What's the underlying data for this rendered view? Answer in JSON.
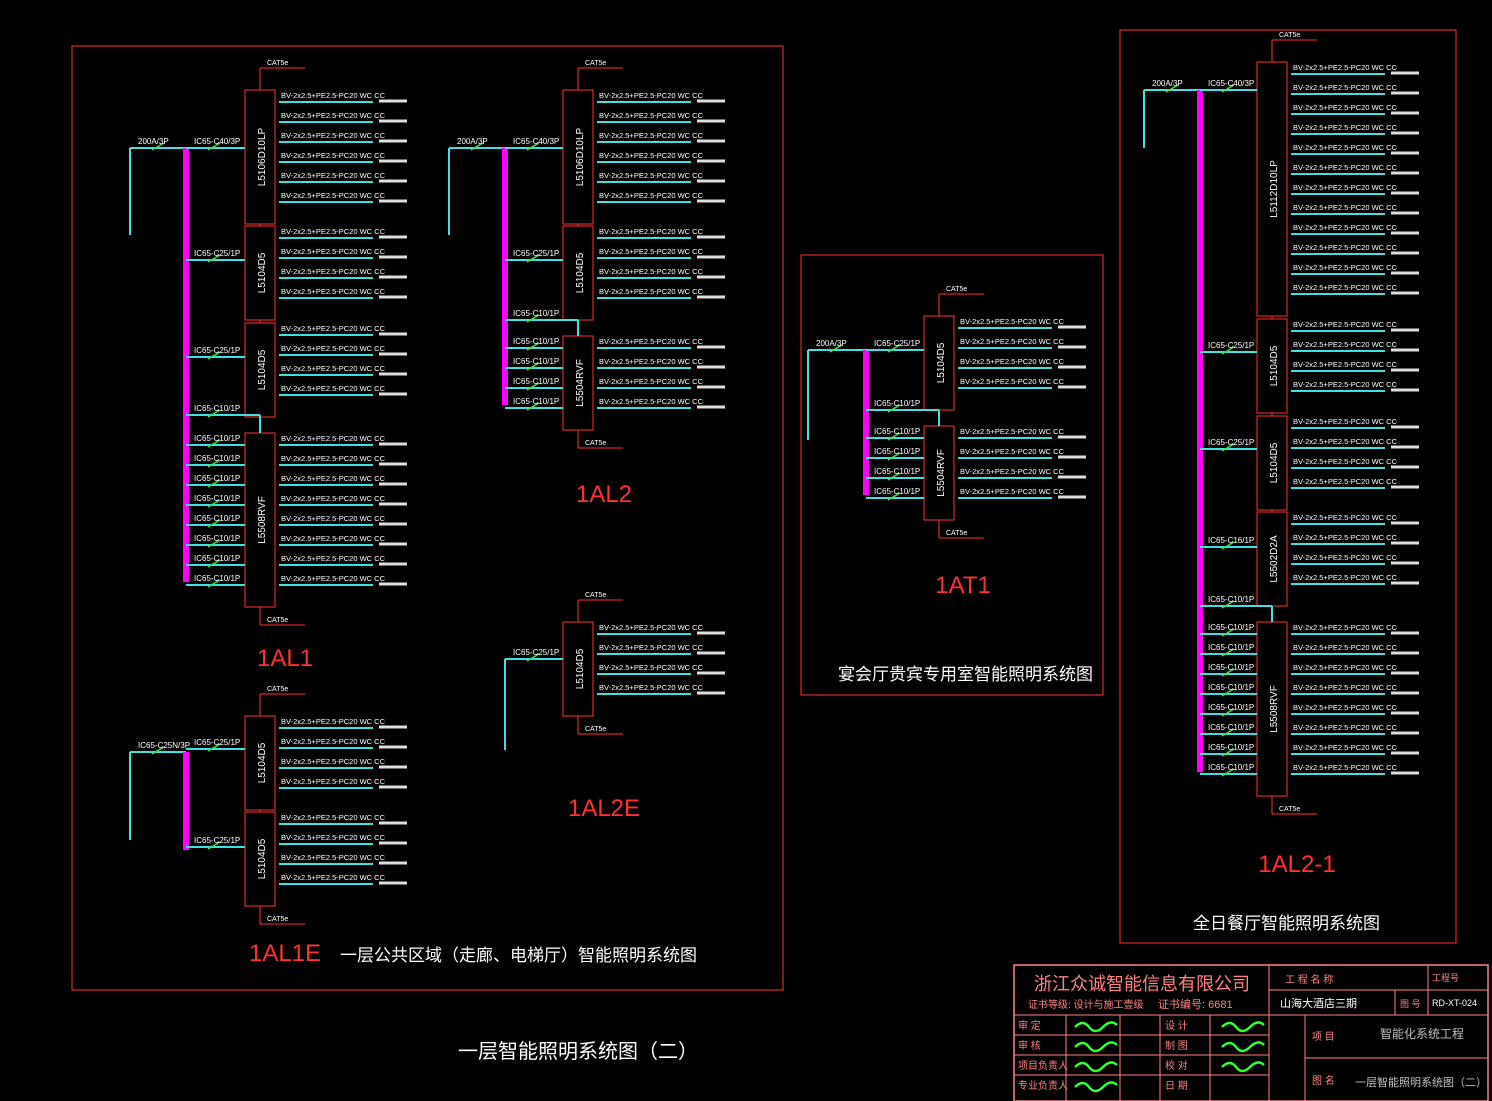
{
  "colors": {
    "background": "#000000",
    "frame": "#ff3030",
    "bus": "#ff00ff",
    "cable": "#40e0e0",
    "breaker": "#40e040",
    "text": "#ffffff",
    "label": "#ff3030",
    "title": "#ffffff",
    "titleblock": "#ff8080",
    "signature": "#30ff30"
  },
  "cable_spec": "BV-2x2.5+PE2.5-PC20 WC CC",
  "network_label": "CAT5e",
  "sheet_title": "一层智能照明系统图（二）",
  "diagrams": [
    {
      "id": "1AL1",
      "label": "1AL1",
      "feeder": "200A/3P",
      "modules": [
        {
          "name": "L5106D10LP",
          "breaker": "IC65-C40/3P",
          "circuits": 6
        },
        {
          "name": "L5104D5",
          "breaker": "IC65-C25/1P",
          "circuits": 4
        },
        {
          "name": "L5104D5",
          "breaker": "IC65-C25/1P",
          "circuits": 4
        },
        {
          "name": "L5508RVF",
          "breaker": "IC65-C10/1P",
          "circuits": 8,
          "branch_breakers": [
            "IC65-C10/1P",
            "IC65-C10/1P",
            "IC65-C10/1P",
            "IC65-C10/1P",
            "IC65-C10/1P",
            "IC65-C10/1P",
            "IC65-C10/1P",
            "IC65-C10/1P"
          ]
        }
      ]
    },
    {
      "id": "1AL2",
      "label": "1AL2",
      "feeder": "200A/3P",
      "modules": [
        {
          "name": "L5106D10LP",
          "breaker": "IC65-C40/3P",
          "circuits": 6
        },
        {
          "name": "L5104D5",
          "breaker": "IC65-C25/1P",
          "circuits": 4
        },
        {
          "name": "L5504RVF",
          "breaker": "IC65-C10/1P",
          "circuits": 4,
          "branch_breakers": [
            "IC65-C10/1P",
            "IC65-C10/1P",
            "IC65-C10/1P",
            "IC65-C10/1P"
          ]
        }
      ]
    },
    {
      "id": "1AL1E",
      "label": "1AL1E",
      "title": "一层公共区域（走廊、电梯厅）智能照明系统图",
      "feeder": "IC65-C25N/3P",
      "modules": [
        {
          "name": "L5104D5",
          "breaker": "IC65-C25/1P",
          "circuits": 4
        },
        {
          "name": "L5104D5",
          "breaker": "IC65-C25/1P",
          "circuits": 4
        }
      ]
    },
    {
      "id": "1AL2E",
      "label": "1AL2E",
      "modules": [
        {
          "name": "L5104D5",
          "breaker": "IC65-C25/1P",
          "circuits": 4
        }
      ]
    },
    {
      "id": "1AT1",
      "label": "1AT1",
      "title": "宴会厅贵宾专用室智能照明系统图",
      "feeder": "200A/3P",
      "modules": [
        {
          "name": "L5104D5",
          "breaker": "IC65-C25/1P",
          "circuits": 4
        },
        {
          "name": "L5504RVF",
          "breaker": "IC65-C10/1P",
          "circuits": 4,
          "branch_breakers": [
            "IC65-C10/1P",
            "IC65-C10/1P",
            "IC65-C10/1P",
            "IC65-C10/1P"
          ]
        }
      ]
    },
    {
      "id": "1AL2-1",
      "label": "1AL2-1",
      "title": "全日餐厅智能照明系统图",
      "feeder": "200A/3P",
      "modules": [
        {
          "name": "L5112D10LP",
          "breaker": "IC65-C40/3P",
          "circuits": 12
        },
        {
          "name": "L5104D5",
          "breaker": "IC65-C25/1P",
          "circuits": 4
        },
        {
          "name": "L5104D5",
          "breaker": "IC65-C25/1P",
          "circuits": 4
        },
        {
          "name": "L5502D2A",
          "breaker": "IC65-C16/1P",
          "circuits": 4
        },
        {
          "name": "L5508RVF",
          "breaker": "IC65-C10/1P",
          "circuits": 8,
          "branch_breakers": [
            "IC65-C10/1P",
            "IC65-C10/1P",
            "IC65-C10/1P",
            "IC65-C10/1P",
            "IC65-C10/1P",
            "IC65-C10/1P",
            "IC65-C10/1P",
            "IC65-C10/1P"
          ]
        }
      ]
    }
  ],
  "title_block": {
    "company": "浙江众诚智能信息有限公司",
    "cert_level": "证书等级: 设计与施工壹级",
    "cert_no": "证书编号: 6681",
    "project_name_label": "工 程 名 称",
    "project_no_label": "工程号",
    "project_name": "山海大酒店三期",
    "drawing_no_label": "图 号",
    "drawing_no": "RD-XT-024",
    "item_label": "项 目",
    "item": "智能化系统工程",
    "drawing_name_label": "图 名",
    "drawing_name": "一层智能照明系统图（二）",
    "roles_left": [
      "审 定",
      "审 核",
      "项目负责人",
      "专业负责人"
    ],
    "roles_right": [
      "设 计",
      "制 图",
      "校 对",
      "日 期"
    ]
  }
}
